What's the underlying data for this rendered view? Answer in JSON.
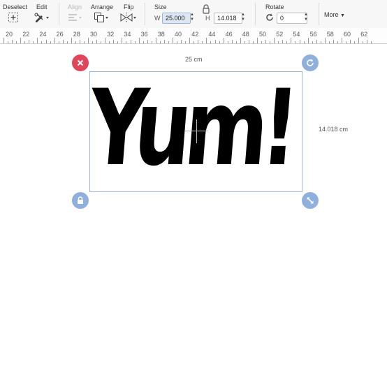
{
  "toolbar": {
    "deselect_label": "Deselect",
    "edit_label": "Edit",
    "align_label": "Align",
    "arrange_label": "Arrange",
    "flip_label": "Flip",
    "size_label": "Size",
    "width_letter": "W",
    "width_value": "25.000",
    "height_letter": "H",
    "height_value": "14.018",
    "rotate_label": "Rotate",
    "rotate_value": "0",
    "more_label": "More"
  },
  "ruler": {
    "labels": [
      "20",
      "22",
      "24",
      "26",
      "28",
      "30",
      "32",
      "34",
      "36",
      "38",
      "40",
      "42",
      "44",
      "46",
      "48",
      "50",
      "52",
      "54",
      "56",
      "58",
      "60",
      "62"
    ]
  },
  "canvas": {
    "width_dimension": "25 cm",
    "height_dimension": "14.018 cm",
    "object_text": "Yum!"
  },
  "colors": {
    "delete_handle": "#e0455b",
    "handle_blue": "#8fb0dd",
    "selection_border": "#9db6dd"
  },
  "icons": {
    "delete": "close-icon",
    "rotate": "rotate-icon",
    "lock": "lock-icon",
    "resize": "resize-icon"
  }
}
